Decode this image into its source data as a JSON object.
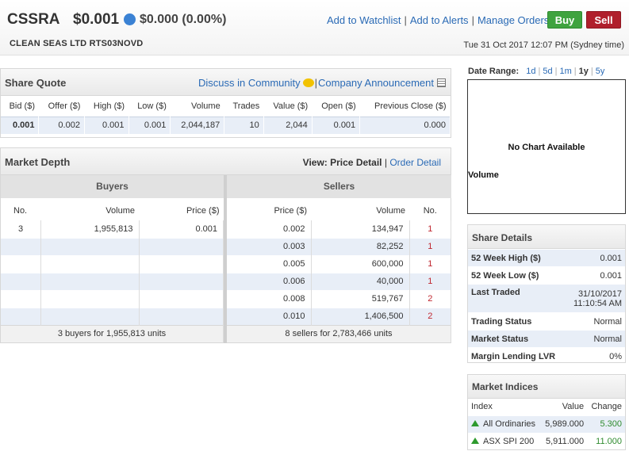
{
  "header": {
    "code": "CSSRA",
    "price": "$0.001",
    "change": "$0.000 (0.00%)",
    "actions": [
      "Add to Watchlist",
      "Add to Alerts",
      "Manage Orders"
    ],
    "buy_label": "Buy",
    "sell_label": "Sell",
    "company": "CLEAN SEAS LTD RTS03NOVD",
    "datetime": "Tue 31 Oct 2017 12:07 PM (Sydney time)"
  },
  "quote": {
    "title": "Share Quote",
    "discuss_label": "Discuss in Community",
    "announcement_label": "Company Announcement",
    "columns": [
      "Bid ($)",
      "Offer ($)",
      "High ($)",
      "Low ($)",
      "Volume",
      "Trades",
      "Value ($)",
      "Open ($)",
      "Previous Close ($)"
    ],
    "values": [
      "0.001",
      "0.002",
      "0.001",
      "0.001",
      "2,044,187",
      "10",
      "2,044",
      "0.001",
      "0.000"
    ]
  },
  "depth": {
    "title": "Market Depth",
    "view_label": "View:",
    "view_current": "Price Detail",
    "view_other": "Order Detail",
    "buyers_label": "Buyers",
    "sellers_label": "Sellers",
    "buyer_columns": [
      "No.",
      "Volume",
      "Price ($)"
    ],
    "seller_columns": [
      "Price ($)",
      "Volume",
      "No."
    ],
    "buyers": [
      [
        "3",
        "1,955,813",
        "0.001"
      ],
      [
        "",
        "",
        ""
      ],
      [
        "",
        "",
        ""
      ],
      [
        "",
        "",
        ""
      ],
      [
        "",
        "",
        ""
      ],
      [
        "",
        "",
        ""
      ]
    ],
    "sellers": [
      [
        "0.002",
        "134,947",
        "1"
      ],
      [
        "0.003",
        "82,252",
        "1"
      ],
      [
        "0.005",
        "600,000",
        "1"
      ],
      [
        "0.006",
        "40,000",
        "1"
      ],
      [
        "0.008",
        "519,767",
        "2"
      ],
      [
        "0.010",
        "1,406,500",
        "2"
      ]
    ],
    "buyers_summary": "3 buyers for 1,955,813 units",
    "sellers_summary": "8 sellers for 2,783,466 units"
  },
  "chart": {
    "date_range_label": "Date Range:",
    "ranges": [
      "1d",
      "5d",
      "1m",
      "1y",
      "5y"
    ],
    "selected_range": "1y",
    "no_chart": "No Chart Available",
    "volume_label": "Volume"
  },
  "details": {
    "title": "Share Details",
    "rows": [
      {
        "k": "52 Week High ($)",
        "v": "0.001"
      },
      {
        "k": "52 Week Low ($)",
        "v": "0.001"
      },
      {
        "k": "Last Traded",
        "v": "31/10/2017",
        "v2": "11:10:54 AM"
      },
      {
        "k": "Trading Status",
        "v": "Normal"
      },
      {
        "k": "Market Status",
        "v": "Normal"
      },
      {
        "k": "Margin Lending LVR",
        "v": "0%"
      }
    ]
  },
  "indices": {
    "title": "Market Indices",
    "columns": [
      "Index",
      "Value",
      "Change"
    ],
    "rows": [
      {
        "name": "All Ordinaries",
        "value": "5,989.000",
        "change": "5.300"
      },
      {
        "name": "ASX SPI 200",
        "value": "5,911.000",
        "change": "11.000"
      }
    ],
    "up_color": "#2e9a2e"
  }
}
